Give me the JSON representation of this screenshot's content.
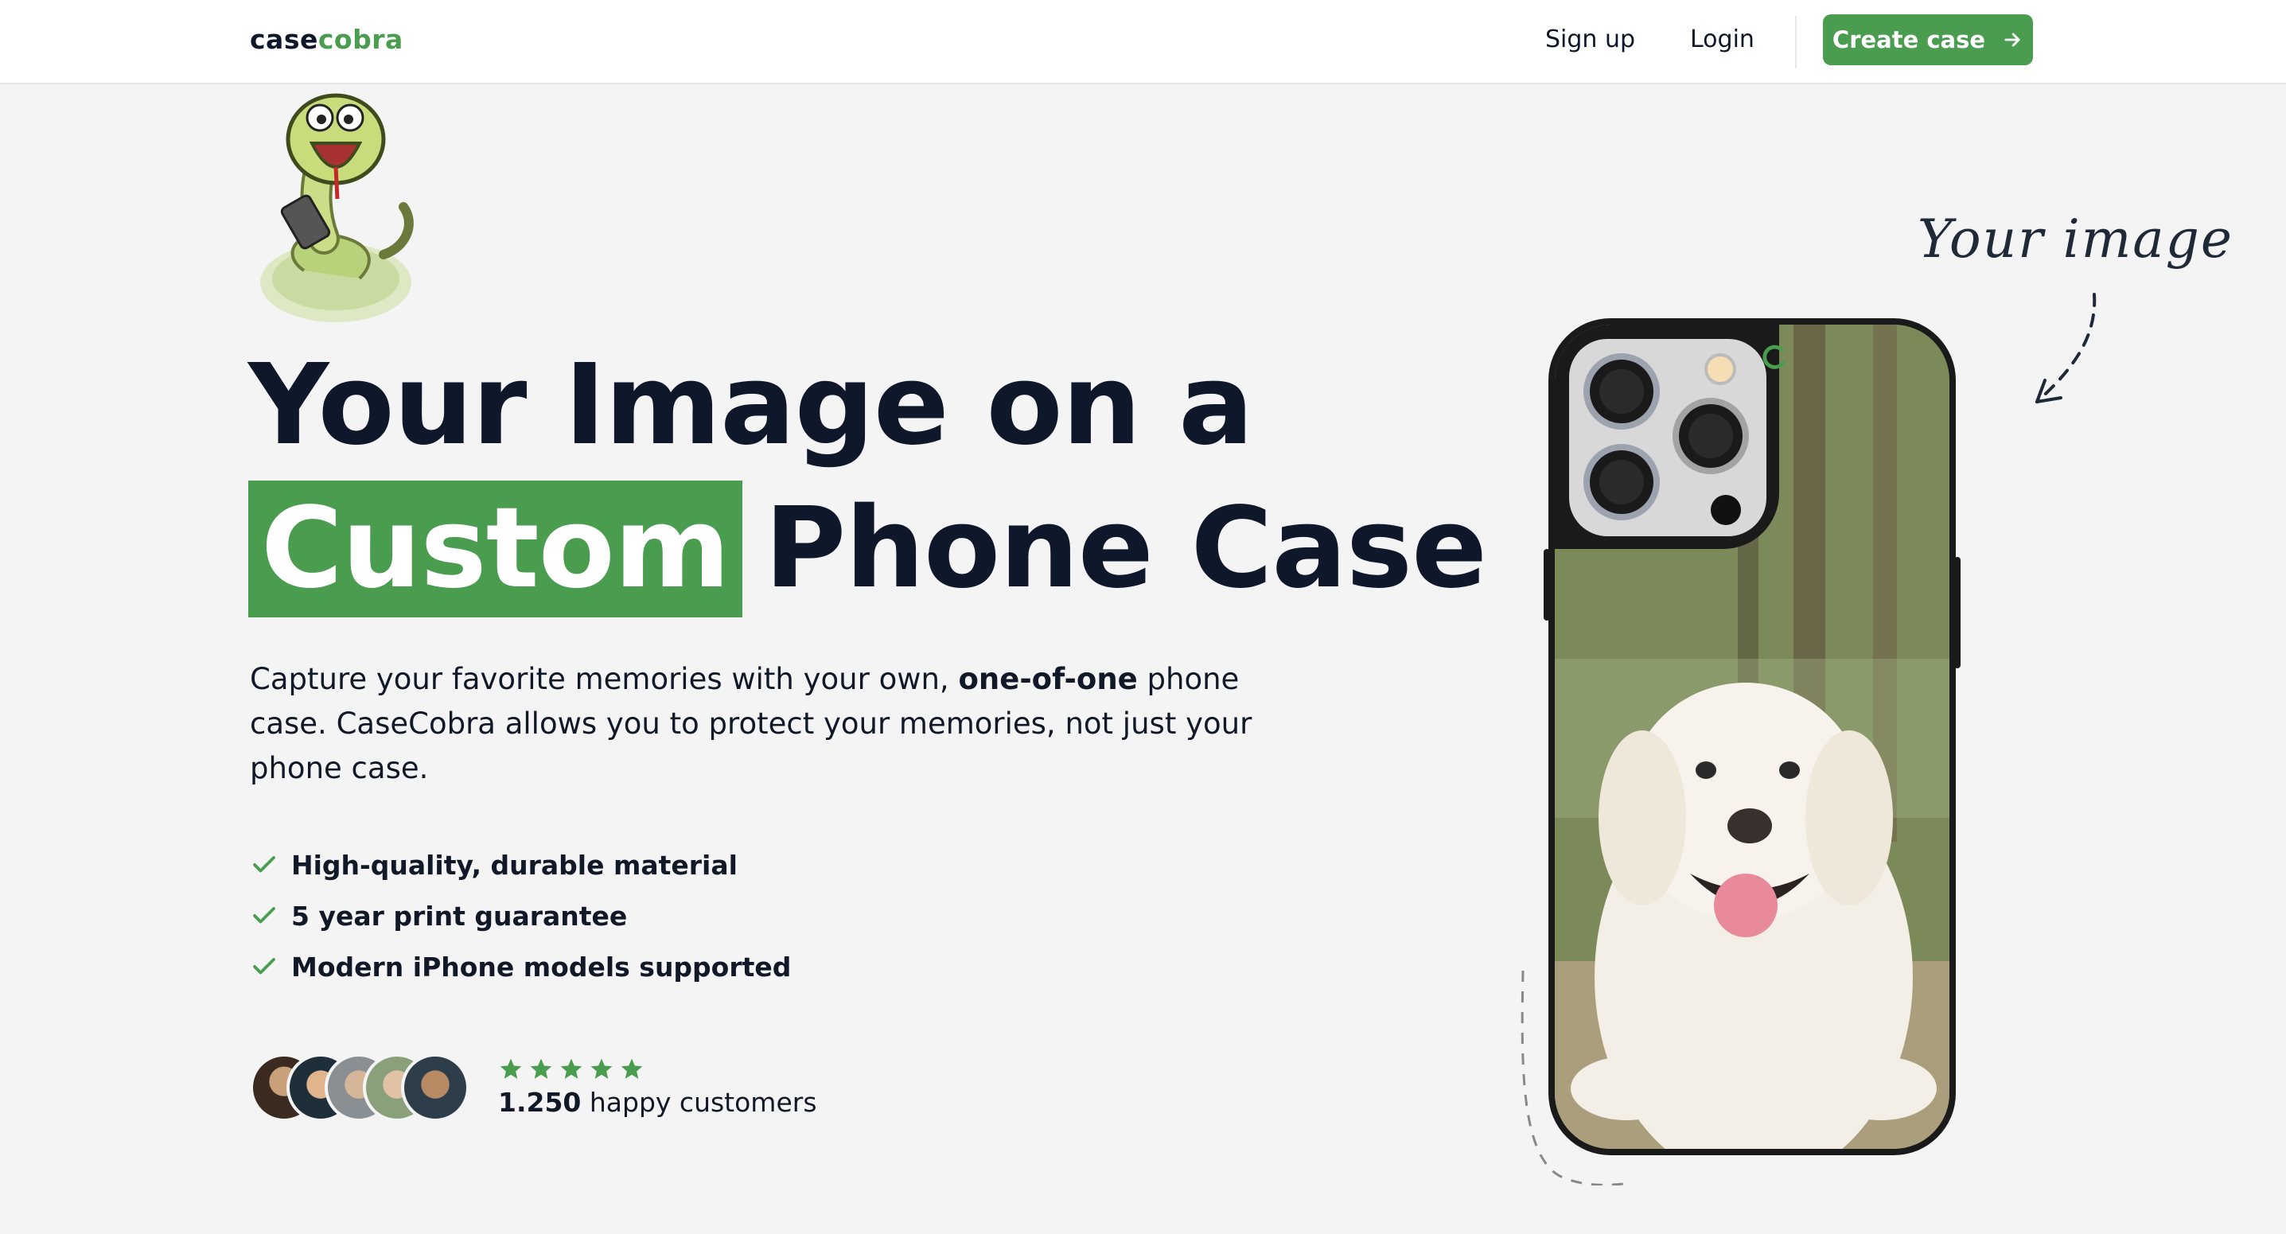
{
  "nav": {
    "logo_part1": "case",
    "logo_part2": "cobra",
    "signup": "Sign up",
    "login": "Login",
    "create_case": "Create case",
    "create_case_icon": "arrow-right-icon"
  },
  "hero": {
    "headline_line1": "Your Image on a",
    "headline_highlight": "Custom",
    "headline_rest": "Phone Case",
    "desc_part1": "Capture your favorite memories with your own, ",
    "desc_bold": "one-of-one",
    "desc_part2": " phone case. CaseCobra allows you to protect your memories, not just your phone case.",
    "features": [
      "High-quality, durable material",
      "5 year print guarantee",
      "Modern iPhone models supported"
    ],
    "feature_icon": "check-icon",
    "rating_stars": 5,
    "customers_count": "1.250",
    "customers_label": " happy customers"
  },
  "annotation": {
    "note": "Your image"
  },
  "colors": {
    "accent": "#4a9d4f",
    "text": "#0f172a",
    "background": "#f4f4f5"
  }
}
